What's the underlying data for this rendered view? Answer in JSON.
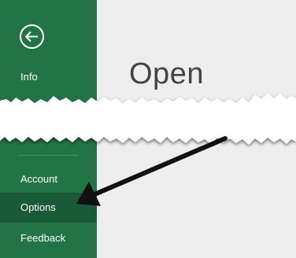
{
  "sidebar": {
    "back_icon": "back-arrow-circle-icon",
    "items": [
      {
        "label": "Info"
      },
      {
        "label": "Account"
      },
      {
        "label": "Options",
        "selected": true
      },
      {
        "label": "Feedback"
      }
    ]
  },
  "main": {
    "title": "Open"
  },
  "colors": {
    "sidebar": "#227447",
    "sidebar_selected": "#185b36",
    "main_background": "#eeeeee",
    "title_text": "#444444"
  }
}
